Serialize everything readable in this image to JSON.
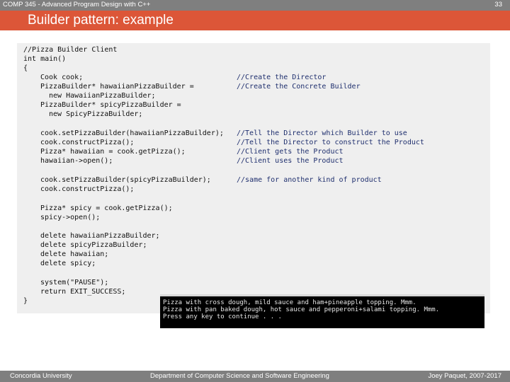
{
  "header": {
    "course": "COMP 345 - Advanced Program Design with C++",
    "slide_number": "33"
  },
  "slide": {
    "title": "Builder pattern: example"
  },
  "code": {
    "l01": "//Pizza Builder Client",
    "l02": "int main()",
    "l03": "{",
    "l04": "Cook cook;",
    "l05": "PizzaBuilder* hawaiianPizzaBuilder =",
    "l06": "new HawaiianPizzaBuilder;",
    "l07": "PizzaBuilder* spicyPizzaBuilder =",
    "l08": "new SpicyPizzaBuilder;",
    "l09": "cook.setPizzaBuilder(hawaiianPizzaBuilder);",
    "l10": "cook.constructPizza();",
    "l11": "Pizza* hawaiian = cook.getPizza();",
    "l12": "hawaiian->open();",
    "l13": "cook.setPizzaBuilder(spicyPizzaBuilder);",
    "l14": "cook.constructPizza();",
    "l15": "Pizza* spicy = cook.getPizza();",
    "l16": "spicy->open();",
    "l17": "delete hawaiianPizzaBuilder;",
    "l18": "delete spicyPizzaBuilder;",
    "l19": "delete hawaiian;",
    "l20": "delete spicy;",
    "l21": "system(\"PAUSE\");",
    "l22": "return EXIT_SUCCESS;",
    "l23": "}",
    "c01": "//Create the Director",
    "c02": "//Create the Concrete Builder",
    "c03": "//Tell the Director which Builder to use",
    "c04": "//Tell the Director to construct the Product",
    "c05": "//Client gets the Product",
    "c06": "//Client uses the Product",
    "c07": "//same for another kind of product"
  },
  "console": {
    "line1": "Pizza with cross dough, mild sauce and ham+pineapple topping. Mmm.",
    "line2": "Pizza with pan baked dough, hot sauce and pepperoni+salami topping. Mmm.",
    "line3": "Press any key to continue . . ."
  },
  "footer": {
    "left": "Concordia University",
    "center": "Department of Computer Science and Software Engineering",
    "right": "Joey Paquet, 2007-2017"
  }
}
